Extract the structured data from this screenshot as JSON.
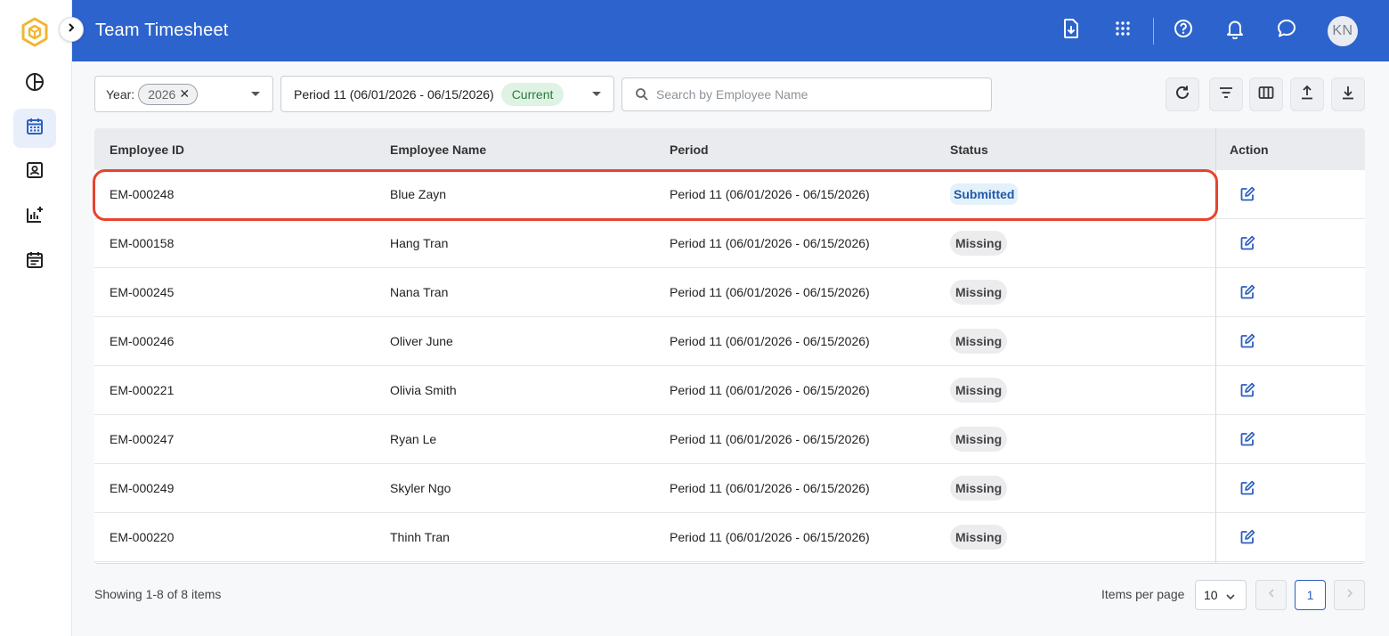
{
  "header": {
    "title": "Team Timesheet",
    "avatar_initials": "KN",
    "icons": [
      "file-download-icon",
      "apps-grid-icon",
      "help-icon",
      "bell-icon",
      "chat-icon"
    ],
    "background": "#2d63cc"
  },
  "sidebar": {
    "items": [
      {
        "icon": "pie-chart-icon",
        "active": false
      },
      {
        "icon": "calendar-icon",
        "active": true
      },
      {
        "icon": "contact-card-icon",
        "active": false
      },
      {
        "icon": "analytics-add-icon",
        "active": false
      },
      {
        "icon": "event-note-icon",
        "active": false
      }
    ]
  },
  "filters": {
    "year_label": "Year:",
    "year_value": "2026",
    "period_value": "Period 11 (06/01/2026 - 06/15/2026)",
    "period_badge": "Current",
    "search_placeholder": "Search by Employee Name",
    "toolbar": [
      "refresh-icon",
      "filter-icon",
      "columns-icon",
      "upload-icon",
      "download-icon"
    ]
  },
  "table": {
    "columns": {
      "id": "Employee ID",
      "name": "Employee Name",
      "period": "Period",
      "status": "Status",
      "action": "Action"
    },
    "rows": [
      {
        "id": "EM-000248",
        "name": "Blue Zayn",
        "period": "Period 11 (06/01/2026 - 06/15/2026)",
        "status": "Submitted"
      },
      {
        "id": "EM-000158",
        "name": "Hang Tran",
        "period": "Period 11 (06/01/2026 - 06/15/2026)",
        "status": "Missing"
      },
      {
        "id": "EM-000245",
        "name": "Nana Tran",
        "period": "Period 11 (06/01/2026 - 06/15/2026)",
        "status": "Missing"
      },
      {
        "id": "EM-000246",
        "name": "Oliver June",
        "period": "Period 11 (06/01/2026 - 06/15/2026)",
        "status": "Missing"
      },
      {
        "id": "EM-000221",
        "name": "Olivia Smith",
        "period": "Period 11 (06/01/2026 - 06/15/2026)",
        "status": "Missing"
      },
      {
        "id": "EM-000247",
        "name": "Ryan Le",
        "period": "Period 11 (06/01/2026 - 06/15/2026)",
        "status": "Missing"
      },
      {
        "id": "EM-000249",
        "name": "Skyler Ngo",
        "period": "Period 11 (06/01/2026 - 06/15/2026)",
        "status": "Missing"
      },
      {
        "id": "EM-000220",
        "name": "Thinh Tran",
        "period": "Period 11 (06/01/2026 - 06/15/2026)",
        "status": "Missing"
      }
    ]
  },
  "footer": {
    "showing": "Showing 1-8 of 8 items",
    "items_per_page_label": "Items per page",
    "items_per_page_value": "10",
    "current_page": "1"
  },
  "colors": {
    "accent": "#2d63cc",
    "highlight": "#e8432d",
    "submitted_bg": "#e3f1fb",
    "missing_bg": "#ececee"
  }
}
